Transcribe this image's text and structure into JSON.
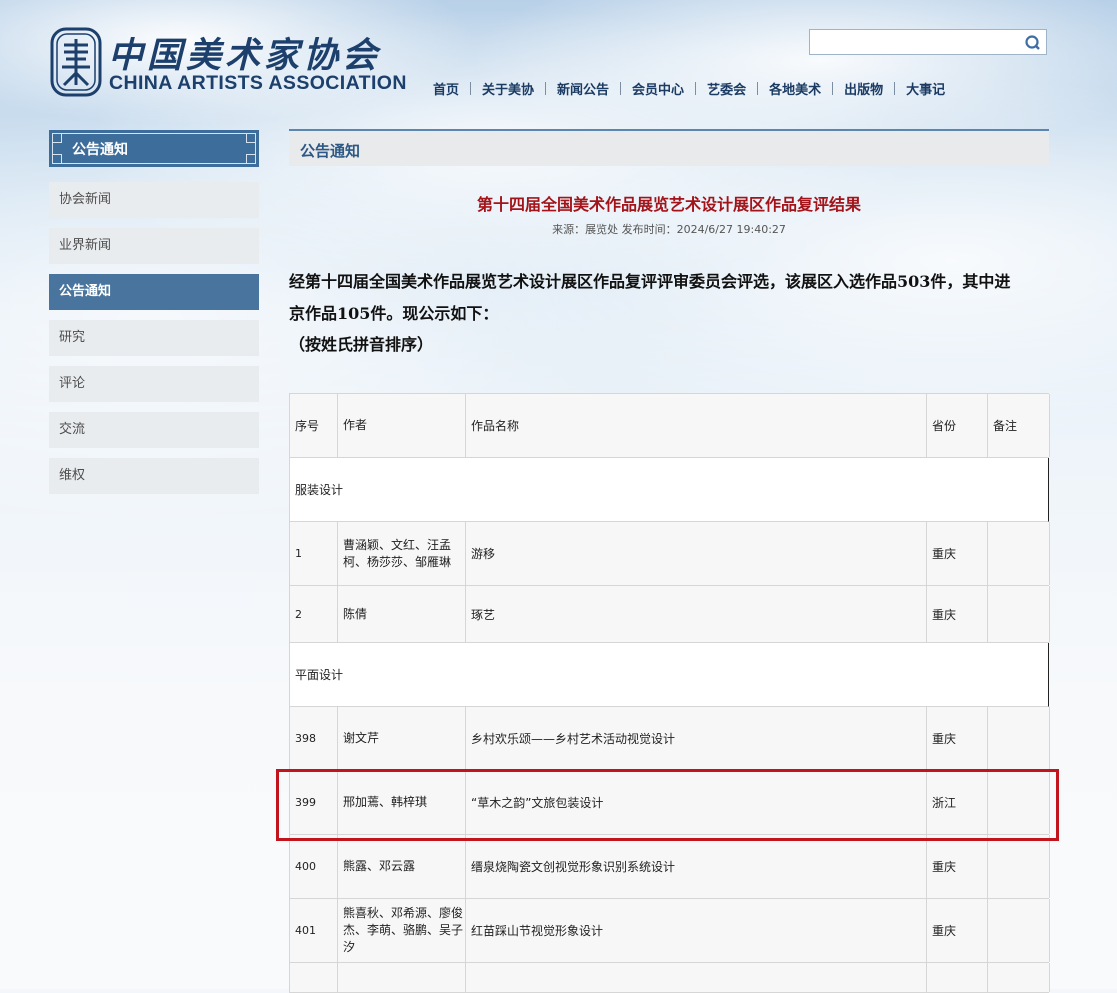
{
  "header": {
    "logo_cn": "中国美术家协会",
    "logo_en": "CHINA ARTISTS ASSOCIATION",
    "search_value": "",
    "nav": [
      "首页",
      "关于美协",
      "新闻公告",
      "会员中心",
      "艺委会",
      "各地美术",
      "出版物",
      "大事记"
    ]
  },
  "sidebar": {
    "title": "公告通知",
    "items": [
      {
        "label": "协会新闻",
        "active": false
      },
      {
        "label": "业界新闻",
        "active": false
      },
      {
        "label": "公告通知",
        "active": true
      },
      {
        "label": "研究",
        "active": false
      },
      {
        "label": "评论",
        "active": false
      },
      {
        "label": "交流",
        "active": false
      },
      {
        "label": "维权",
        "active": false
      }
    ]
  },
  "main": {
    "heading": "公告通知",
    "title": "第十四届全国美术作品展览艺术设计展区作品复评结果",
    "meta": "来源：展览处 发布时间：2024/6/27 19:40:27",
    "body_line1": "经第十四届全国美术作品展览艺术设计展区作品复评评审委员会评选，该展区入选作品503件，其中进",
    "body_line2": "京作品105件。现公示如下：",
    "body_line3": "（按姓氏拼音排序）"
  },
  "table": {
    "headers": [
      "序号",
      "作者",
      "作品名称",
      "省份",
      "备注"
    ],
    "rows": [
      {
        "type": "section",
        "label": "服装设计"
      },
      {
        "type": "data",
        "no": "1",
        "author": "曹涵颖、文红、汪孟柯、杨莎莎、邹雁琳",
        "work": "游移",
        "province": "重庆",
        "note": ""
      },
      {
        "type": "data",
        "no": "2",
        "author": "陈倩",
        "work": "琢艺",
        "province": "重庆",
        "note": ""
      },
      {
        "type": "section",
        "label": "平面设计"
      },
      {
        "type": "data",
        "no": "398",
        "author": "谢文芹",
        "work": "乡村欢乐颂——乡村艺术活动视觉设计",
        "province": "重庆",
        "note": ""
      },
      {
        "type": "data",
        "no": "399",
        "author": "邢加蔫、韩梓琪",
        "work": "“草木之韵”文旅包装设计",
        "province": "浙江",
        "note": ""
      },
      {
        "type": "data",
        "no": "400",
        "author": "熊露、邓云露",
        "work": "缙泉烧陶瓷文创视觉形象识别系统设计",
        "province": "重庆",
        "note": ""
      },
      {
        "type": "data",
        "no": "401",
        "author": "熊喜秋、邓希源、廖俊杰、李萌、骆鹏、吴子汐",
        "work": "红苗踩山节视觉形象设计",
        "province": "重庆",
        "note": ""
      }
    ]
  },
  "colors": {
    "brand_blue": "#1c3f6c",
    "active_blue": "#48749d",
    "title_red": "#a3141a",
    "highlight_red": "#c2141c"
  }
}
